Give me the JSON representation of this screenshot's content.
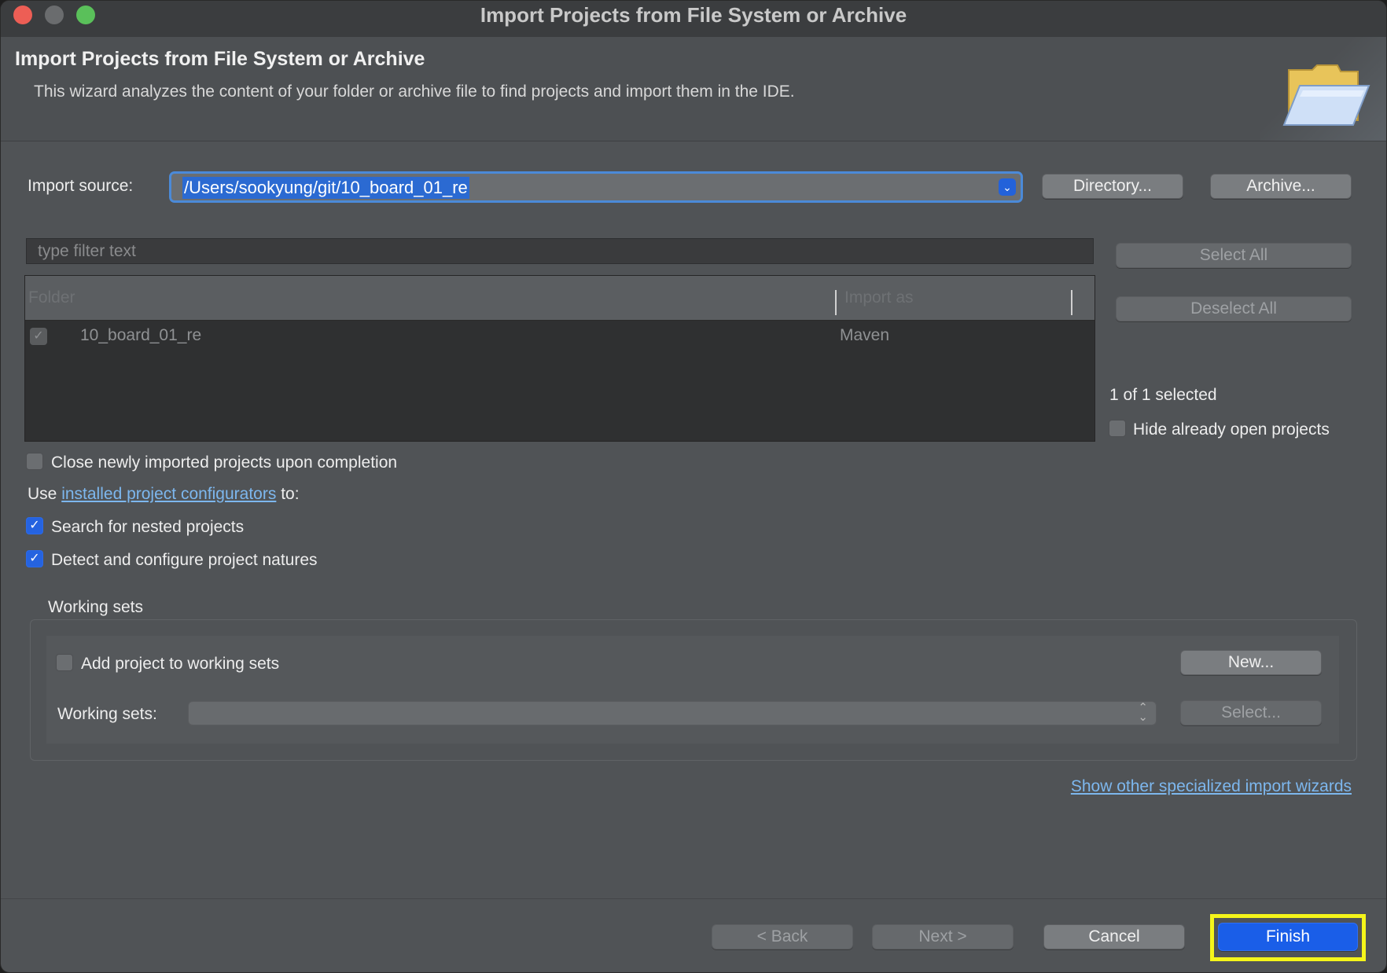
{
  "window": {
    "title": "Import Projects from File System or Archive"
  },
  "header": {
    "title": "Import Projects from File System or Archive",
    "description": "This wizard analyzes the content of your folder or archive file to find projects and import them in the IDE."
  },
  "import_source": {
    "label": "Import source:",
    "value": "/Users/sookyung/git/10_board_01_re",
    "directory_button": "Directory...",
    "archive_button": "Archive..."
  },
  "filter": {
    "placeholder": "type filter text"
  },
  "table": {
    "columns": [
      "Folder",
      "Import as"
    ],
    "rows": [
      {
        "folder": "10_board_01_re",
        "import_as": "Maven",
        "checked": true
      }
    ]
  },
  "side": {
    "select_all": "Select All",
    "deselect_all": "Deselect All",
    "selected_count": "1 of 1 selected",
    "hide_open_label": "Hide already open projects"
  },
  "options": {
    "close_imported_label": "Close newly imported projects upon completion",
    "use_prefix": "Use",
    "configurators_link": "installed project configurators",
    "use_suffix": "to:",
    "search_nested_label": "Search for nested projects",
    "detect_natures_label": "Detect and configure project natures"
  },
  "working_sets": {
    "group_label": "Working sets",
    "add_label": "Add project to working sets",
    "new_button": "New...",
    "sets_label": "Working sets:",
    "select_button": "Select..."
  },
  "other_wizards_link": "Show other specialized import wizards",
  "footer": {
    "back": "< Back",
    "next": "Next >",
    "cancel": "Cancel",
    "finish": "Finish"
  },
  "colors": {
    "accent": "#1a5ee8",
    "highlight": "#f5f51a",
    "link": "#7db7ee"
  }
}
